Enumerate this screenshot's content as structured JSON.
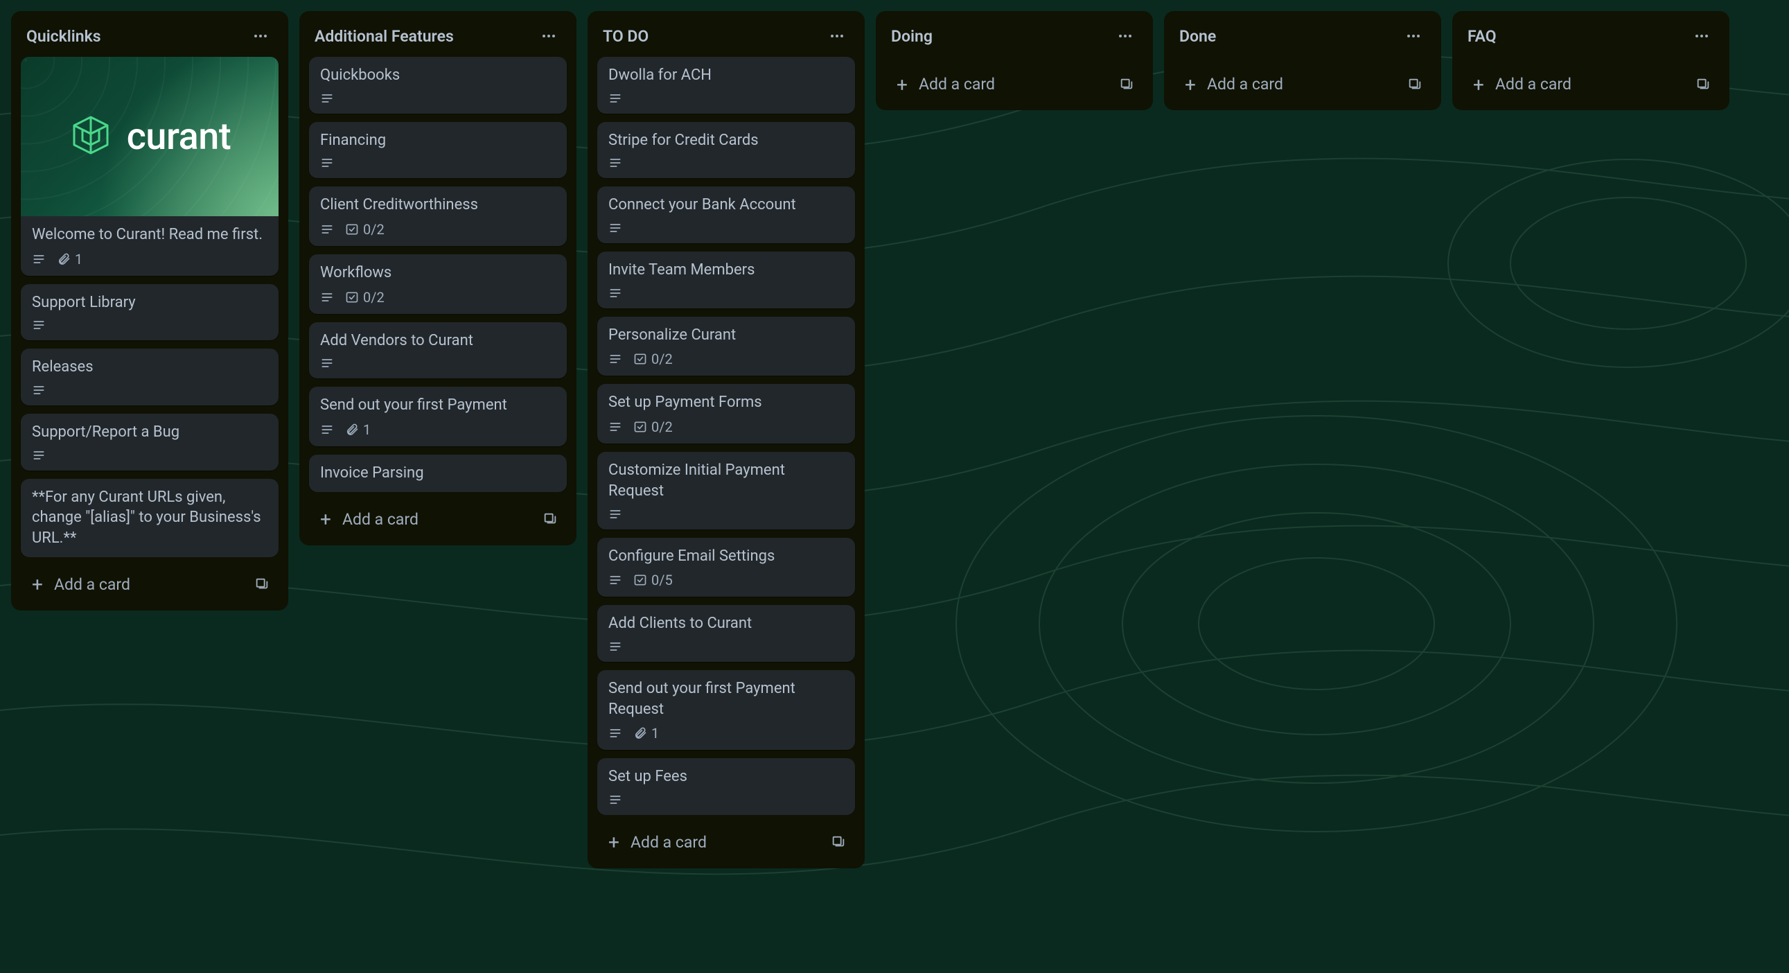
{
  "brand": "curant",
  "add_card_label": "Add a card",
  "lists": [
    {
      "title": "Quicklinks",
      "cards": [
        {
          "title": "Welcome to Curant! Read me first.",
          "cover": true,
          "desc": true,
          "attachments": "1"
        },
        {
          "title": "Support Library",
          "desc": true
        },
        {
          "title": "Releases",
          "desc": true
        },
        {
          "title": "Support/Report a Bug",
          "desc": true
        },
        {
          "title": "**For any Curant URLs given, change \"[alias]\" to your Business's URL.**"
        }
      ]
    },
    {
      "title": "Additional Features",
      "cards": [
        {
          "title": "Quickbooks",
          "desc": true
        },
        {
          "title": "Financing",
          "desc": true
        },
        {
          "title": "Client Creditworthiness",
          "desc": true,
          "checklist": "0/2"
        },
        {
          "title": "Workflows",
          "desc": true,
          "checklist": "0/2"
        },
        {
          "title": "Add Vendors to Curant",
          "desc": true
        },
        {
          "title": "Send out your first Payment",
          "desc": true,
          "attachments": "1"
        },
        {
          "title": "Invoice Parsing"
        }
      ]
    },
    {
      "title": "TO DO",
      "cards": [
        {
          "title": "Dwolla for ACH",
          "desc": true
        },
        {
          "title": "Stripe for Credit Cards",
          "desc": true
        },
        {
          "title": "Connect your Bank Account",
          "desc": true
        },
        {
          "title": "Invite Team Members",
          "desc": true
        },
        {
          "title": "Personalize Curant",
          "desc": true,
          "checklist": "0/2"
        },
        {
          "title": "Set up Payment Forms",
          "desc": true,
          "checklist": "0/2"
        },
        {
          "title": "Customize Initial Payment Request",
          "desc": true
        },
        {
          "title": "Configure Email Settings",
          "desc": true,
          "checklist": "0/5"
        },
        {
          "title": "Add Clients to Curant",
          "desc": true
        },
        {
          "title": "Send out your first Payment Request",
          "desc": true,
          "attachments": "1"
        },
        {
          "title": "Set up Fees",
          "desc": true
        }
      ]
    },
    {
      "title": "Doing",
      "cards": []
    },
    {
      "title": "Done",
      "cards": []
    },
    {
      "title": "FAQ",
      "cards": []
    }
  ]
}
